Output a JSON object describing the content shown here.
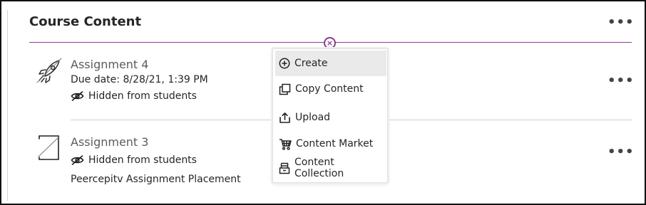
{
  "header": {
    "title": "Course Content",
    "more_label": "•••"
  },
  "items": [
    {
      "title": "Assignment 4",
      "due": "Due date: 8/28/21, 1:39 PM",
      "visibility": "Hidden from students",
      "icon": "rocket-icon"
    },
    {
      "title": "Assignment 3",
      "visibility": "Hidden from students",
      "description": "Peercepitv Assignment Placement",
      "icon": "document-icon"
    }
  ],
  "add_menu": {
    "close_label": "×",
    "items": [
      {
        "label": "Create",
        "icon": "plus-circle-icon"
      },
      {
        "label": "Copy Content",
        "icon": "copy-icon"
      },
      {
        "label": "Upload",
        "icon": "upload-icon"
      },
      {
        "label": "Content Market",
        "icon": "cart-icon"
      },
      {
        "label": "Content Collection",
        "icon": "collection-icon"
      }
    ]
  },
  "colors": {
    "accent": "#8a3d8f",
    "text": "#262626",
    "muted": "#5c5c5c"
  }
}
